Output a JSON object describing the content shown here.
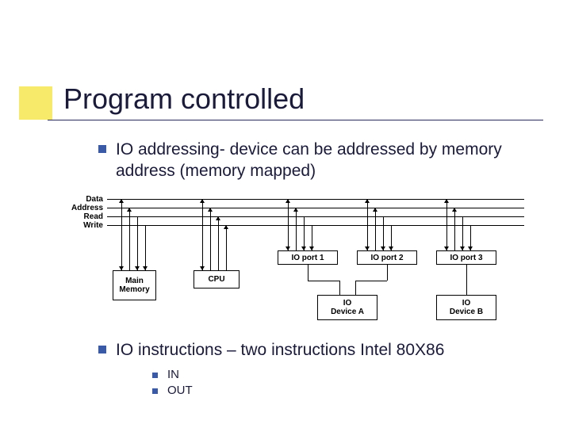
{
  "title": "Program controlled",
  "bullets": {
    "p1": "IO addressing- device can be addressed by memory address (memory mapped)",
    "p2": "IO instructions – two instructions Intel 80X86",
    "s1": "IN",
    "s2": "OUT"
  },
  "diagram": {
    "signals": [
      "Data",
      "Address",
      "Read",
      "Write"
    ],
    "main_memory": "Main\nMemory",
    "cpu": "CPU",
    "port1": "IO port 1",
    "port2": "IO port 2",
    "port3": "IO port 3",
    "devA": "IO\nDevice A",
    "devB": "IO\nDevice B"
  }
}
